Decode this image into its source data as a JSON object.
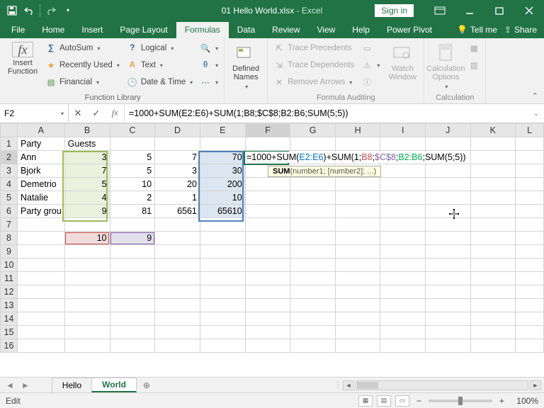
{
  "title": {
    "filename": "01 Hello World.xlsx",
    "app": "Excel",
    "signin": "Sign in"
  },
  "tabs": {
    "file": "File",
    "home": "Home",
    "insert": "Insert",
    "pageLayout": "Page Layout",
    "formulas": "Formulas",
    "data": "Data",
    "review": "Review",
    "view": "View",
    "help": "Help",
    "powerPivot": "Power Pivot",
    "tellMe": "Tell me",
    "share": "Share"
  },
  "ribbon": {
    "insertFunction": "Insert\nFunction",
    "autoSum": "AutoSum",
    "recentlyUsed": "Recently Used",
    "financial": "Financial",
    "logical": "Logical",
    "text": "Text",
    "dateTime": "Date & Time",
    "definedNames": "Defined\nNames",
    "tracePrecedents": "Trace Precedents",
    "traceDependents": "Trace Dependents",
    "removeArrows": "Remove Arrows",
    "watchWindow": "Watch\nWindow",
    "calcOptions": "Calculation\nOptions",
    "group1": "Function Library",
    "group2": "Formula Auditing",
    "group3": "Calculation"
  },
  "namebox": "F2",
  "formula": "=1000+SUM(E2:E6)+SUM(1;B8;$C$8;B2:B6;SUM(5;5))",
  "formulaParts": {
    "p1": "=1000+SUM(",
    "p2": "E2:E6",
    "p3": ")+SUM(1;",
    "p4": "B8",
    "p5": ";",
    "p6": "$C$8",
    "p7": ";",
    "p8": "B2:B6",
    "p9": ";SUM(5;5))"
  },
  "tooltip": {
    "fn": "SUM",
    "args": "(number1; [number2]; ...)"
  },
  "colHeaders": [
    "A",
    "B",
    "C",
    "D",
    "E",
    "F",
    "G",
    "H",
    "I",
    "J",
    "K",
    "L"
  ],
  "rows": {
    "1": {
      "A": "Party",
      "B": "Guests"
    },
    "2": {
      "A": "Ann",
      "B": "3",
      "C": "5",
      "D": "7",
      "E": "70"
    },
    "3": {
      "A": "Bjork",
      "B": "7",
      "C": "5",
      "D": "3",
      "E": "30"
    },
    "4": {
      "A": "Demetrio",
      "B": "5",
      "C": "10",
      "D": "20",
      "E": "200"
    },
    "5": {
      "A": "Natalie",
      "B": "4",
      "C": "2",
      "D": "1",
      "E": "10"
    },
    "6": {
      "A": "Party grou",
      "B": "9",
      "C": "81",
      "D": "6561",
      "E": "65610"
    },
    "8": {
      "B": "10",
      "C": "9"
    }
  },
  "sheetTabs": {
    "tab1": "Hello",
    "tab2": "World"
  },
  "status": {
    "mode": "Edit",
    "zoom": "100%"
  },
  "colWidths": {
    "rowhdr": 24,
    "A": 64,
    "B": 64,
    "C": 64,
    "D": 64,
    "E": 64,
    "F": 64,
    "G": 64,
    "H": 64,
    "I": 64,
    "J": 64,
    "K": 64,
    "L": 40
  },
  "chart_data": {
    "type": "table",
    "columns": [
      "Party",
      "Guests",
      "C",
      "D",
      "E"
    ],
    "rows": [
      [
        "Ann",
        3,
        5,
        7,
        70
      ],
      [
        "Bjork",
        7,
        5,
        3,
        30
      ],
      [
        "Demetrio",
        5,
        10,
        20,
        200
      ],
      [
        "Natalie",
        4,
        2,
        1,
        10
      ],
      [
        "Party grou",
        9,
        81,
        6561,
        65610
      ]
    ],
    "extra": {
      "B8": 10,
      "C8": 9
    },
    "active_formula": "=1000+SUM(E2:E6)+SUM(1;B8;$C$8;B2:B6;SUM(5;5))"
  }
}
